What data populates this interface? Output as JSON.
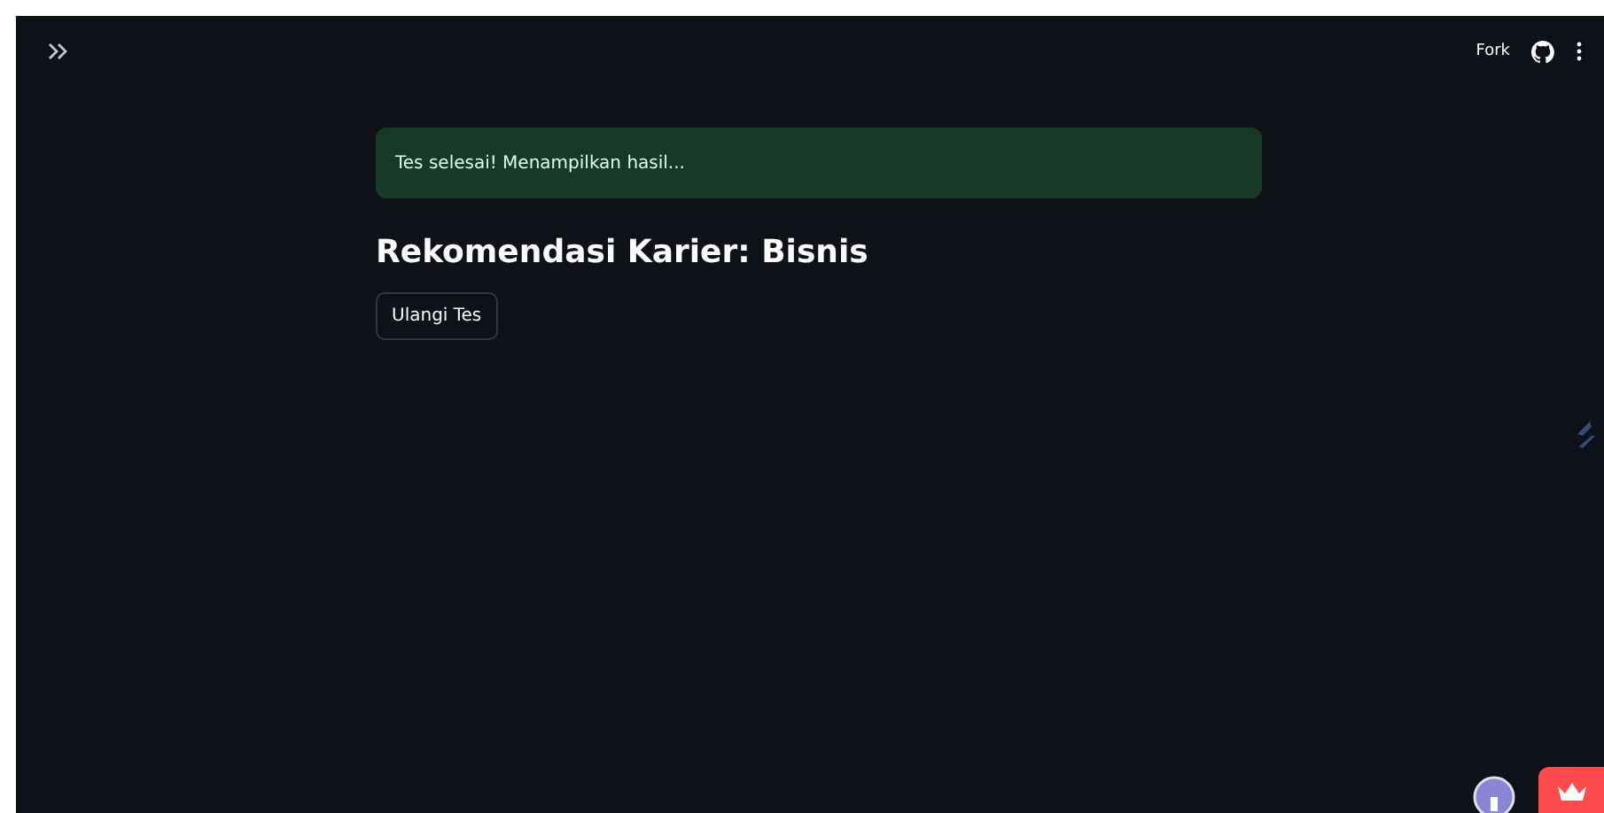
{
  "header": {
    "fork_label": "Fork"
  },
  "alert": {
    "message": "Tes selesai! Menampilkan hasil..."
  },
  "heading": "Rekomendasi Karier: Bisnis",
  "button": "Ulangi Tes"
}
